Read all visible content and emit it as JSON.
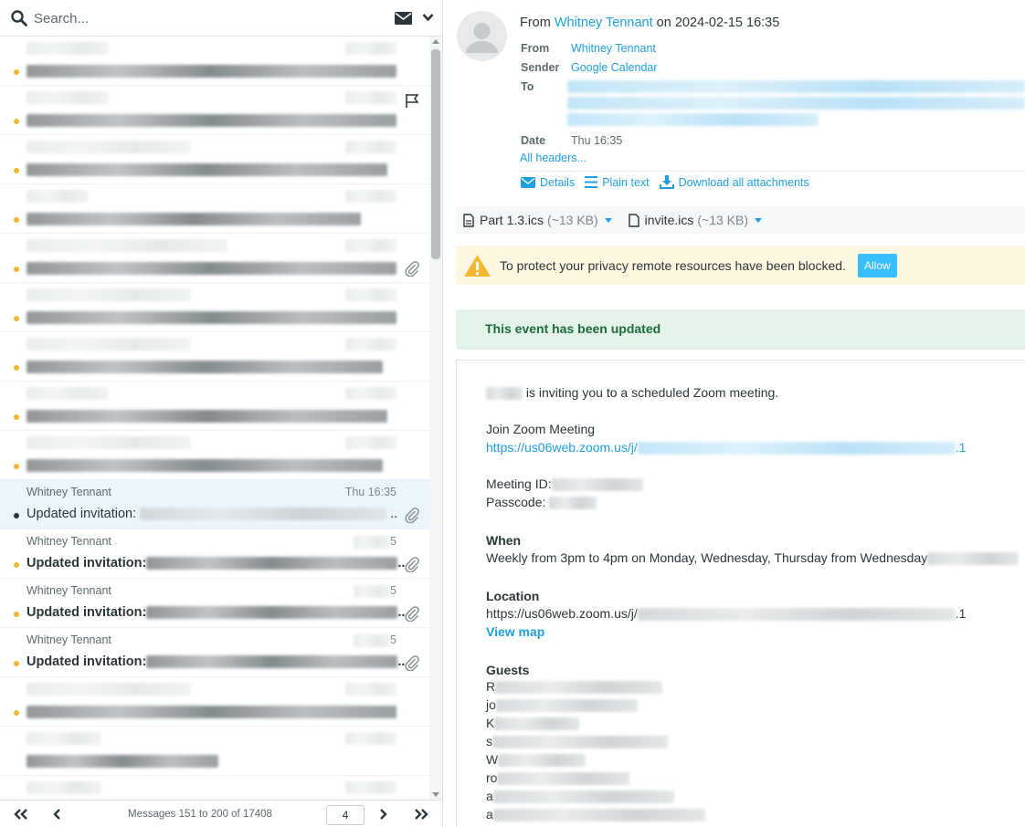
{
  "search": {
    "placeholder": "Search..."
  },
  "list": {
    "messages": [
      {
        "from": "Whitney Tennant",
        "date": "Thu 16:35",
        "subject": "Updated invitation:",
        "selected": true,
        "attachment": true
      },
      {
        "from": "Whitney Tennant",
        "date": "5",
        "subject": "Updated invitation:",
        "selected": false,
        "attachment": true
      },
      {
        "from": "Whitney Tennant",
        "date": "5",
        "subject": "Updated invitation:",
        "selected": false,
        "attachment": true
      },
      {
        "from": "Whitney Tennant",
        "date": "5",
        "subject": "Updated invitation:",
        "selected": false,
        "attachment": true
      }
    ]
  },
  "pager": {
    "count": "Messages 151 to 200 of 17408",
    "page": "4"
  },
  "header": {
    "from_prefix": "From",
    "from_name": "Whitney Tennant",
    "on_text": "on 2024-02-15 16:35",
    "labels": {
      "from": "From",
      "sender": "Sender",
      "to": "To",
      "date": "Date"
    },
    "from_value": "Whitney Tennant",
    "sender_value": "Google Calendar",
    "date_value": "Thu 16:35",
    "all_headers": "All headers..."
  },
  "actions": {
    "details": "Details",
    "plain_text": "Plain text",
    "download_all": "Download all attachments"
  },
  "attachments": [
    {
      "name": "Part 1.3.ics",
      "size": "(~13 KB)"
    },
    {
      "name": "invite.ics",
      "size": "(~13 KB)"
    }
  ],
  "privacy": {
    "text": "To protect your privacy remote resources have been blocked.",
    "allow": "Allow"
  },
  "event": {
    "status": "This event has been updated"
  },
  "body": {
    "inviting": "is inviting you to a scheduled Zoom meeting.",
    "join_title": "Join Zoom Meeting",
    "join_link_prefix": "https://us06web.zoom.us/j/",
    "join_link_suffix": ".1",
    "meeting_id_label": "Meeting ID:",
    "passcode_label": "Passcode:",
    "when_title": "When",
    "when_text": "Weekly from 3pm to 4pm on Monday, Wednesday, Thursday from Wednesday",
    "location_title": "Location",
    "location_prefix": "https://us06web.zoom.us/j/",
    "location_suffix": ".1",
    "view_map": "View map",
    "guests_title": "Guests",
    "guest_initials": [
      "R",
      "jo",
      "K",
      "s",
      "W",
      "ro",
      "a",
      "a"
    ]
  },
  "colors": {
    "accent": "#1e9fe0",
    "unread_dot": "#f5b833",
    "selected_row": "#eaf6fc",
    "event_bg": "#e4f3ea",
    "privacy_bg": "#fdf6e0"
  },
  "icons": [
    "search-icon",
    "envelope-icon",
    "chevron-down-icon",
    "flag-icon",
    "paperclip-icon",
    "first-page-icon",
    "prev-page-icon",
    "next-page-icon",
    "last-page-icon",
    "user-avatar-icon",
    "envelope-icon",
    "list-icon",
    "download-icon",
    "file-icon",
    "warning-icon"
  ]
}
